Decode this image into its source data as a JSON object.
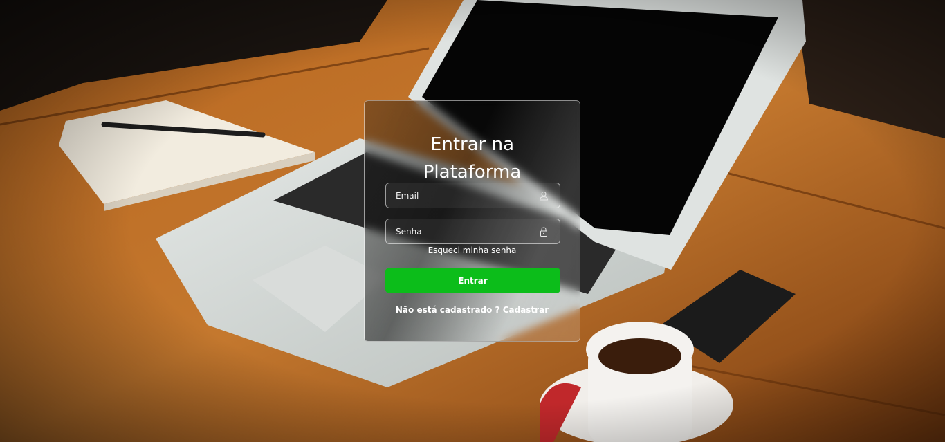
{
  "login": {
    "title_line1": "Entrar na",
    "title_line2": "Plataforma",
    "email_placeholder": "Email",
    "password_placeholder": "Senha",
    "forgot_label": "Esqueci minha senha",
    "submit_label": "Entrar",
    "register_prompt": "Não está cadastrado ?",
    "register_link": "Cadastrar"
  },
  "icons": {
    "email": "user-icon",
    "password": "lock-icon"
  },
  "colors": {
    "primary_button": "#0cbd1a",
    "text": "#ffffff"
  }
}
